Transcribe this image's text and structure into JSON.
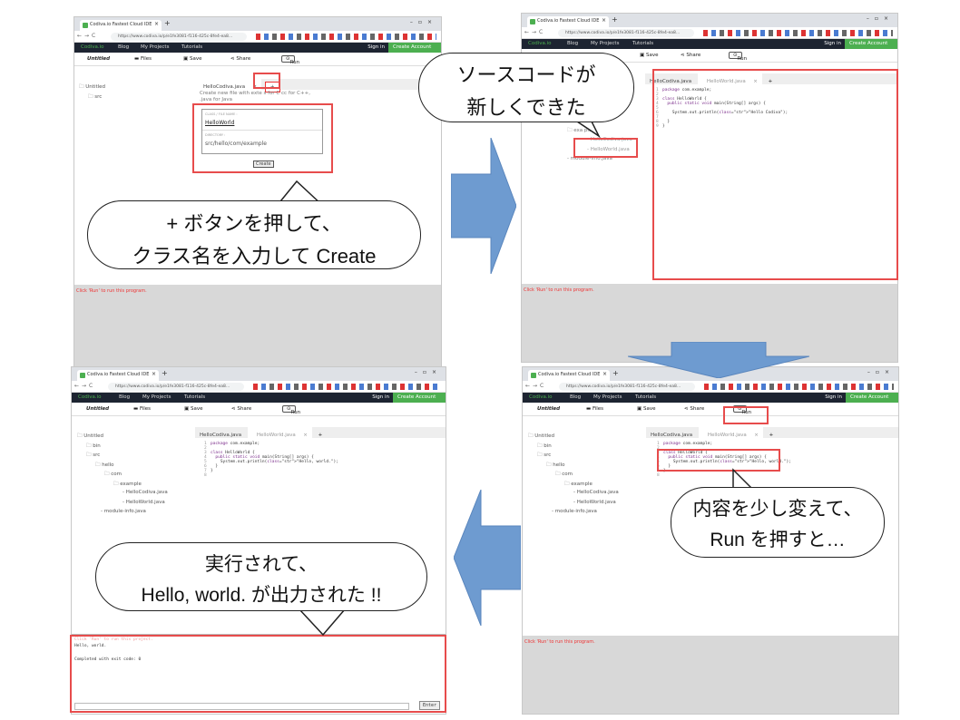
{
  "browser": {
    "tab_title": "Codiva.io Fastest Cloud IDE",
    "url": "https://www.codiva.io/p/e1fe3081-f116-425c-8fe4-ea8..."
  },
  "site": {
    "logo": "Codiva.io",
    "nav_blog": "Blog",
    "nav_projects": "My Projects",
    "nav_tutorials": "Tutorials",
    "sign_in": "Sign in",
    "create_account": "Create Account"
  },
  "toolbar": {
    "project_name": "Untitled",
    "files": "Files",
    "save": "Save",
    "share": "Share",
    "run": "Run"
  },
  "panel1": {
    "tree": [
      "Untitled",
      "src"
    ],
    "tab_name": "HelloCodiva.java",
    "plus": "+",
    "hint": "Create new file with exte  s  for C   cc for C++,",
    "hint2": ".java for Java",
    "class_label": "CLASS / FILE NAME :",
    "class_value": "HelloWorld",
    "dir_label": "DIRECTORY :",
    "dir_value": "src/hello/com/example",
    "create_btn": "Create",
    "console_msg": "Click 'Run' to run this program.",
    "bubble_line1": "+ ボタンを押して、",
    "bubble_line2": "クラス名を入力して Create"
  },
  "panel2": {
    "tree_partial": [
      "exa   ple",
      "HelloCodiva.java",
      "HelloWorld.java",
      "module-info.java"
    ],
    "tab1": "HelloCodiva.java",
    "tab2": "HelloWorld.java",
    "plus": "+",
    "code": [
      "package com.example;",
      "",
      "class HelloWorld {",
      "  public static void main(String[] args) {",
      "",
      "    System.out.println(\"Hello Codiva\");",
      "",
      "  }",
      "}"
    ],
    "console_msg": "Click 'Run' to run this program.",
    "bubble_line1": "ソースコードが",
    "bubble_line2": "新しくできた"
  },
  "panel3": {
    "tree": [
      "Untitled",
      "bin",
      "src",
      "hello",
      "com",
      "example",
      "HelloCodiva.java",
      "HelloWorld.java",
      "module-info.java"
    ],
    "tab1": "HelloCodiva.java",
    "tab2": "HelloWorld.java",
    "plus": "+",
    "code": [
      "package com.example;",
      "",
      "class HelloWorld {",
      "  public static void main(String[] args) {",
      "    System.out.println(\"Hello, world.\");",
      "  }",
      "}",
      ""
    ],
    "console_header": "Click 'Run' to run this project.",
    "output1": "Hello, world.",
    "output2": "Completed with exit code: 0",
    "enter_btn": "Enter",
    "bubble_line1": "実行されて、",
    "bubble_line2": "Hello, world. が出力された !!"
  },
  "panel4": {
    "tree": [
      "Untitled",
      "bin",
      "src",
      "hello",
      "com",
      "example",
      "HelloCodiva.java",
      "HelloWorld.java",
      "module-info.java"
    ],
    "tab1": "HelloCodiva.java",
    "tab2": "HelloWorld.java",
    "plus": "+",
    "code": [
      "package com.example;",
      "",
      "class HelloWorld {",
      "  public static void main(String[] args) {",
      "    System.out.println(\"Hello, world.\");",
      "  }",
      "}",
      ""
    ],
    "console_msg": "Click 'Run' to run this program.",
    "bubble_line1": "内容を少し変えて、",
    "bubble_line2": "Run を押すと…"
  },
  "colors": {
    "highlight": "#e74c4c",
    "arrow": "#6e9bd0",
    "accent": "#4caf50"
  }
}
